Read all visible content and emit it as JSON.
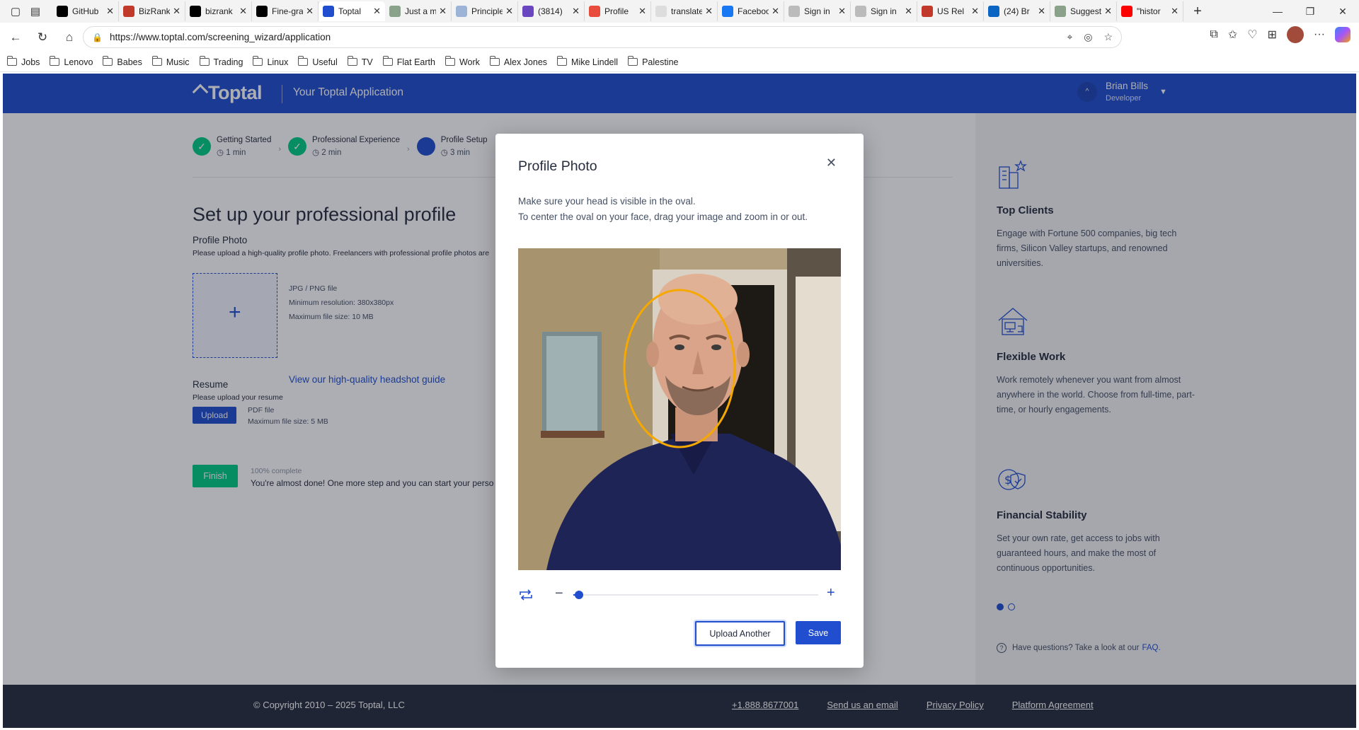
{
  "browser": {
    "tabs": [
      {
        "label": "GitHub",
        "icon": "github-icon",
        "color": "#000000"
      },
      {
        "label": "BizRank",
        "icon": "flag-icon",
        "color": "#c0392b"
      },
      {
        "label": "bizrank",
        "icon": "github-icon",
        "color": "#000000"
      },
      {
        "label": "Fine-grained",
        "icon": "github-icon",
        "color": "#000000"
      },
      {
        "label": "Toptal",
        "icon": "toptal-icon",
        "color": "#204ecf",
        "active": true
      },
      {
        "label": "Just a moment",
        "icon": "page-icon",
        "color": "#8aa18a"
      },
      {
        "label": "Principles",
        "icon": "word-icon",
        "color": "#9db4d8"
      },
      {
        "label": "(3814)",
        "icon": "mail-icon",
        "color": "#6b46c1"
      },
      {
        "label": "Profile",
        "icon": "profile-icon",
        "color": "#e74c3c"
      },
      {
        "label": "translate",
        "icon": "google-icon",
        "color": "#dddddd"
      },
      {
        "label": "Facebook",
        "icon": "facebook-icon",
        "color": "#1877f2"
      },
      {
        "label": "Sign in",
        "icon": "user-icon",
        "color": "#bbbbbb"
      },
      {
        "label": "Sign in",
        "icon": "user-icon",
        "color": "#bbbbbb"
      },
      {
        "label": "US Rel",
        "icon": "flag-icon",
        "color": "#c0392b"
      },
      {
        "label": "(24) Br",
        "icon": "linkedin-icon",
        "color": "#0a66c2"
      },
      {
        "label": "Suggest",
        "icon": "page-icon",
        "color": "#8aa18a"
      },
      {
        "label": "\"histor",
        "icon": "youtube-icon",
        "color": "#ff0000"
      }
    ],
    "url": "https://www.toptal.com/screening_wizard/application",
    "bookmarks": [
      "Jobs",
      "Lenovo",
      "Babes",
      "Music",
      "Trading",
      "Linux",
      "Useful",
      "TV",
      "Flat Earth",
      "Work",
      "Alex Jones",
      "Mike Lindell",
      "Palestine"
    ]
  },
  "header": {
    "logo": "Toptal",
    "subtitle": "Your Toptal Application",
    "user_name": "Brian Bills",
    "user_role": "Developer"
  },
  "steps": [
    {
      "label": "Getting Started",
      "time": "1 min",
      "state": "done"
    },
    {
      "label": "Professional Experience",
      "time": "2 min",
      "state": "done"
    },
    {
      "label": "Profile Setup",
      "time": "3 min",
      "state": "current"
    }
  ],
  "main": {
    "title": "Set up your professional profile",
    "photo_label": "Profile Photo",
    "photo_help": "Please upload a high-quality profile photo. Freelancers with professional profile photos are",
    "req_format": "JPG / PNG file",
    "req_resolution": "Minimum resolution: 380x380px",
    "req_size": "Maximum file size: 10 MB",
    "guide_link": "View our high-quality headshot guide",
    "resume_label": "Resume",
    "resume_help": "Please upload your resume",
    "upload_button": "Upload",
    "resume_format": "PDF file",
    "resume_size": "Maximum file size: 5 MB",
    "finish_button": "Finish",
    "progress_text": "100% complete",
    "progress": 1.0,
    "almost_text": "You're almost done! One more step and you can start your perso"
  },
  "sidebar": {
    "perks": [
      {
        "title": "Top Clients",
        "text": "Engage with Fortune 500 companies, big tech firms, Silicon Valley startups, and renowned universities.",
        "icon": "buildings-icon"
      },
      {
        "title": "Flexible Work",
        "text": "Work remotely whenever you want from almost anywhere in the world. Choose from full-time, part-time, or hourly engagements.",
        "icon": "home-office-icon"
      },
      {
        "title": "Financial Stability",
        "text": "Set your own rate, get access to jobs with guaranteed hours, and make the most of continuous opportunities.",
        "icon": "money-shield-icon"
      }
    ],
    "carousel_active": 1,
    "carousel_total": 2,
    "faq_text": "Have questions? Take a look at our",
    "faq_link": "FAQ."
  },
  "footer": {
    "copyright": "© Copyright 2010 – 2025 Toptal, LLC",
    "links": [
      "+1.888.8677001",
      "Send us an email",
      "Privacy Policy",
      "Platform Agreement"
    ]
  },
  "modal": {
    "title": "Profile Photo",
    "close_icon": "close-icon",
    "instruction_1": "Make sure your head is visible in the oval.",
    "instruction_2": "To center the oval on your face, drag your image and zoom in or out.",
    "zoom_level": 0.0,
    "upload_another_label": "Upload Another",
    "save_label": "Save",
    "oval_color": "#f5a800"
  },
  "colors": {
    "brand": "#204ecf",
    "success": "#00cc83",
    "footer": "#262d3d"
  }
}
